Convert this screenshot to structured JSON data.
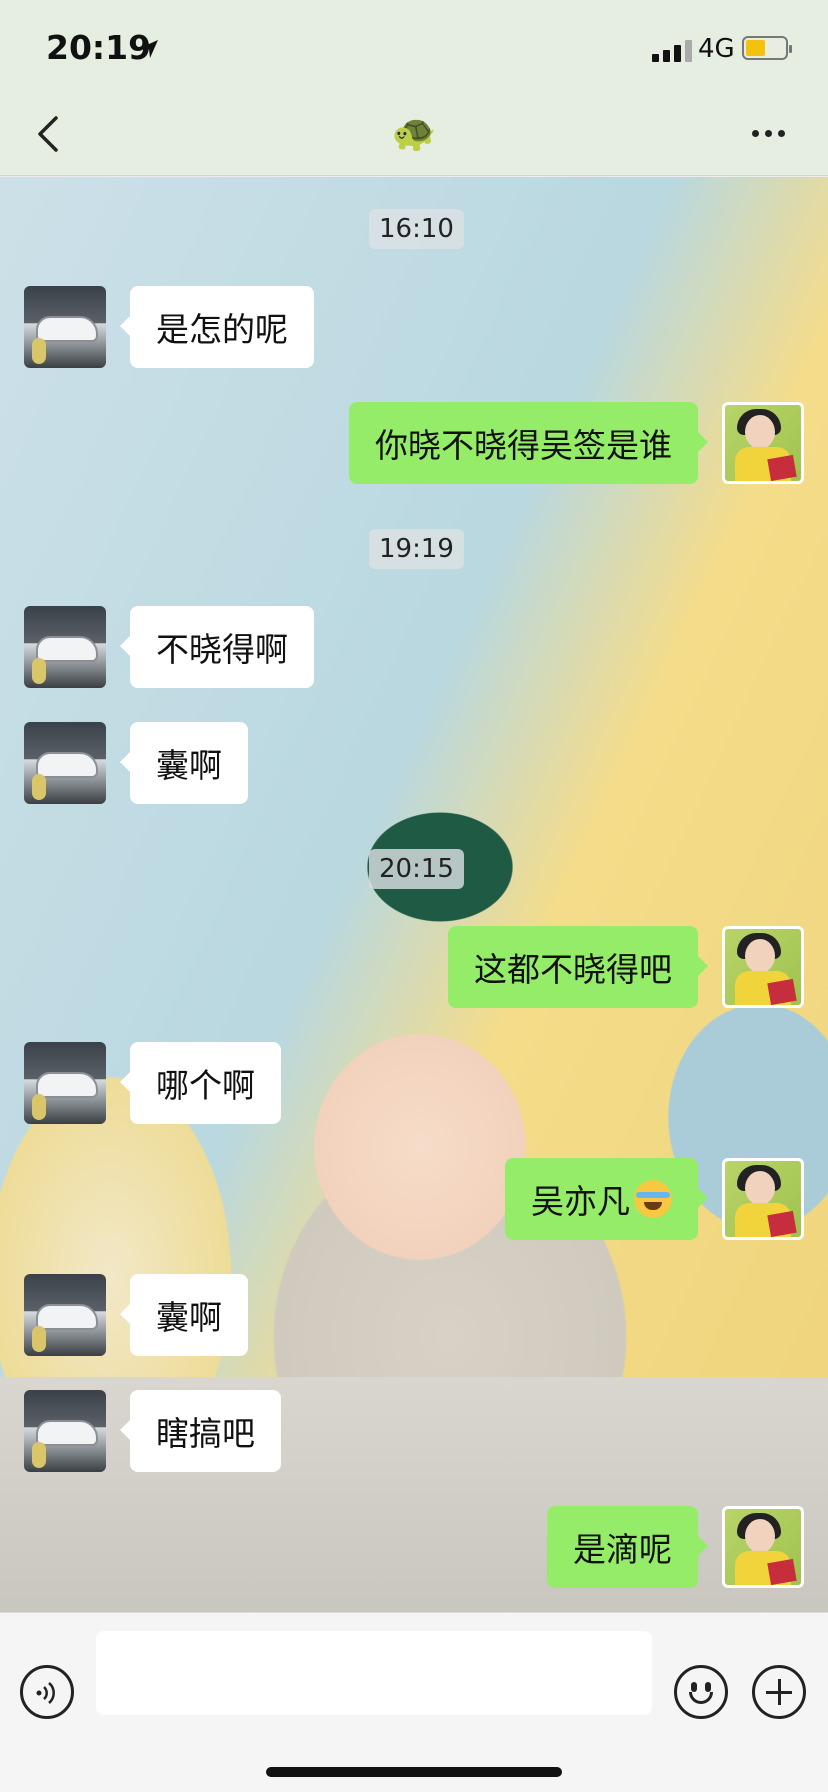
{
  "status": {
    "time": "20:19",
    "network": "4G"
  },
  "header": {
    "title": "🐢"
  },
  "messages": [
    {
      "type": "timestamp",
      "text": "16:10"
    },
    {
      "type": "in",
      "text": "是怎的呢"
    },
    {
      "type": "out",
      "text": "你晓不晓得吴签是谁"
    },
    {
      "type": "timestamp",
      "text": "19:19"
    },
    {
      "type": "in",
      "text": "不晓得啊"
    },
    {
      "type": "in",
      "text": "囊啊"
    },
    {
      "type": "timestamp",
      "text": "20:15"
    },
    {
      "type": "out",
      "text": "这都不晓得吧"
    },
    {
      "type": "in",
      "text": "哪个啊"
    },
    {
      "type": "out",
      "text": "吴亦凡",
      "emoji": "face-with-tears-of-joy"
    },
    {
      "type": "in",
      "text": "囊啊"
    },
    {
      "type": "in",
      "text": "瞎搞吧"
    },
    {
      "type": "out",
      "text": "是滴呢"
    }
  ],
  "colors": {
    "outgoing": "#95ec69",
    "incoming": "#ffffff",
    "header": "#e6eee2"
  },
  "input": {
    "value": "",
    "placeholder": ""
  }
}
